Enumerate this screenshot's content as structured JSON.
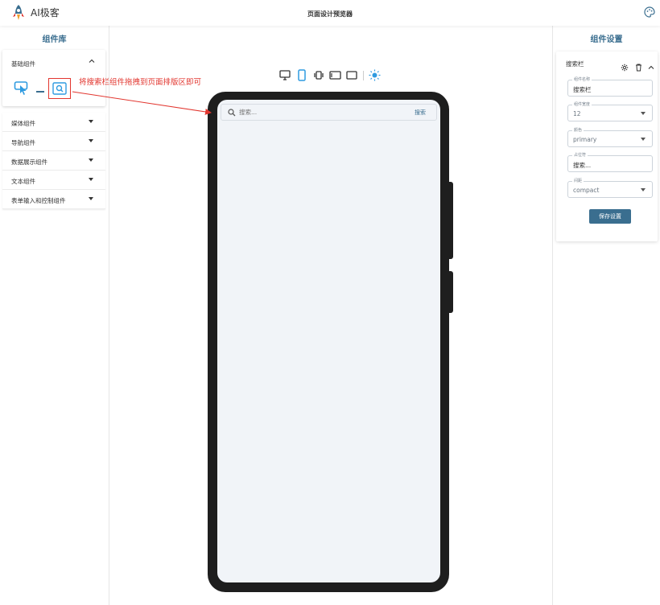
{
  "header": {
    "app_title": "AI极客",
    "page_title": "页面设计预览器"
  },
  "left_panel": {
    "heading": "组件库",
    "basic": {
      "title": "基础组件"
    },
    "categories": [
      {
        "label": "媒体组件"
      },
      {
        "label": "导航组件"
      },
      {
        "label": "数据展示组件"
      },
      {
        "label": "文本组件"
      },
      {
        "label": "表单输入和控制组件"
      }
    ]
  },
  "annotation": {
    "text": "将搜索栏组件拖拽到页面排版区即可"
  },
  "preview": {
    "search": {
      "placeholder": "搜索...",
      "button": "搜索"
    }
  },
  "right_panel": {
    "heading": "组件设置",
    "card_title": "搜索栏",
    "fields": [
      {
        "label": "组件名称",
        "value": "搜索栏"
      },
      {
        "label": "组件宽度",
        "value": "12"
      },
      {
        "label": "颜色",
        "value": "primary"
      },
      {
        "label": "占位符",
        "value": "搜索..."
      },
      {
        "label": "间距",
        "value": "compact"
      }
    ],
    "save_label": "保存设置"
  },
  "colors": {
    "accent": "#3a6e8f",
    "annotation": "#e2362f",
    "phone_frame": "#1e1e1e",
    "screen_bg": "#f1f4f8"
  }
}
